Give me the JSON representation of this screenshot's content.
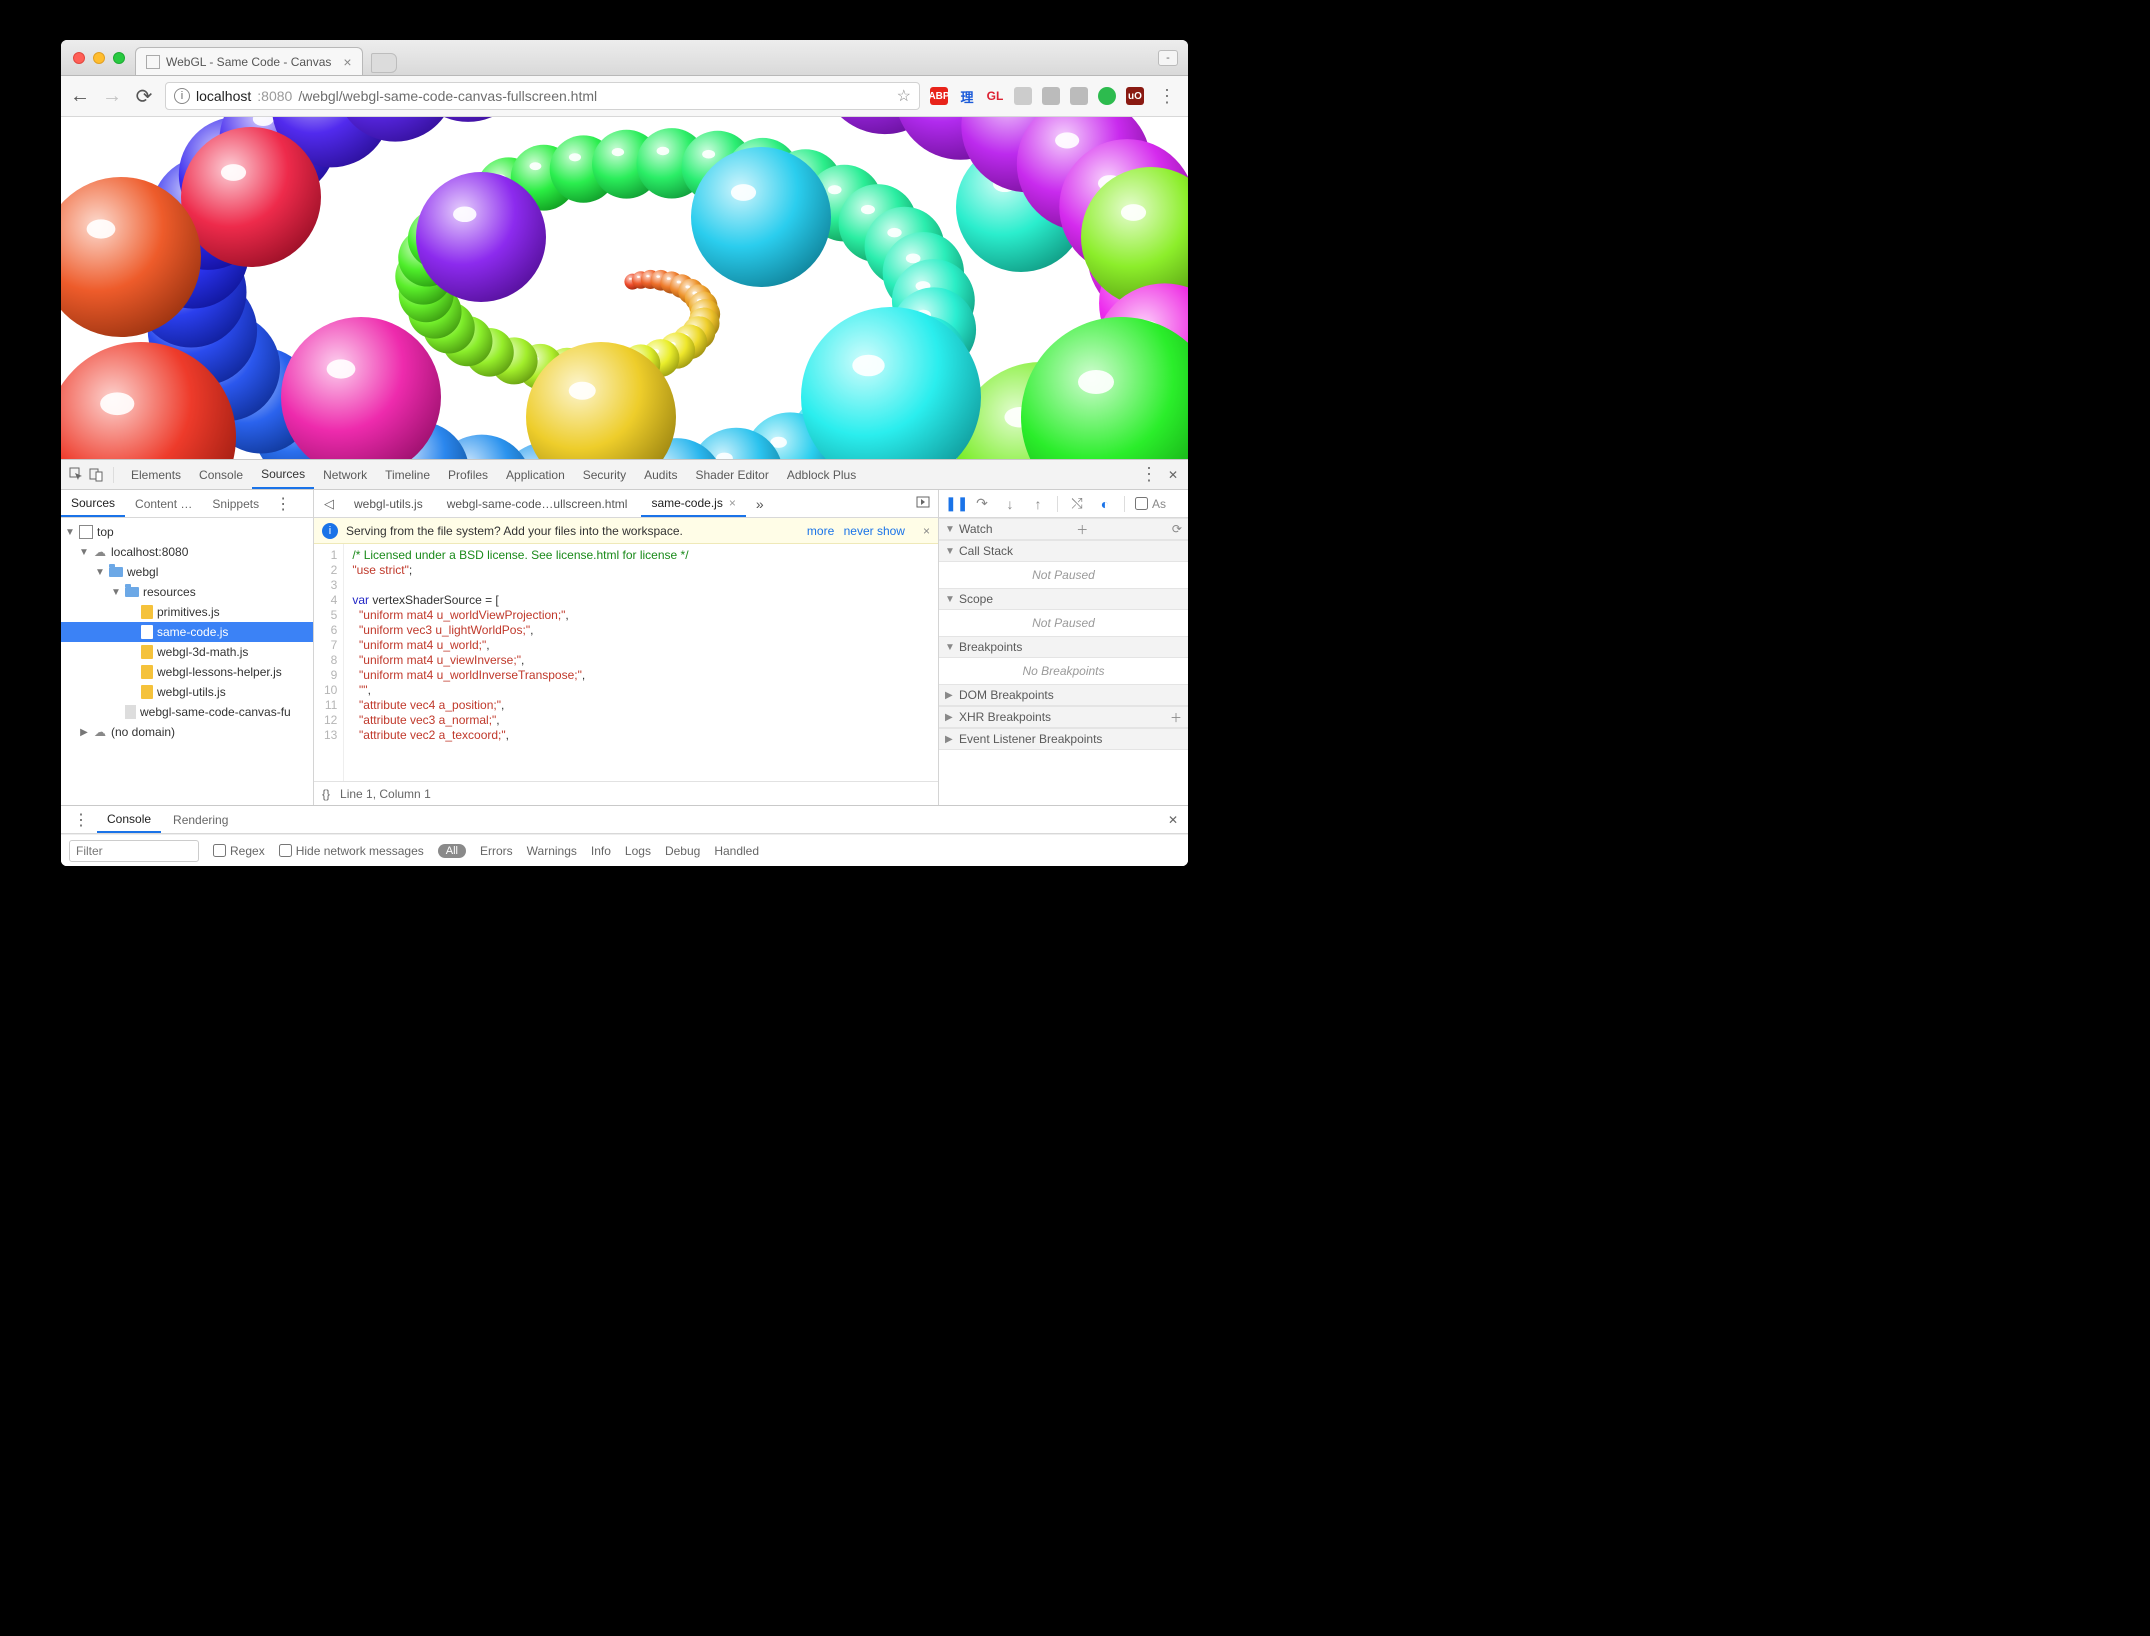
{
  "window": {
    "tab_title": "WebGL - Same Code - Canvas",
    "minimize_glyph": "-"
  },
  "toolbar": {
    "url_host": "localhost",
    "url_port": ":8080",
    "url_path": "/webgl/webgl-same-code-canvas-fullscreen.html",
    "ext_abp": "ABP",
    "ext_ri": "理",
    "ext_gl": "GL",
    "ext_uo": "uO"
  },
  "devtools": {
    "tabs": [
      "Elements",
      "Console",
      "Sources",
      "Network",
      "Timeline",
      "Profiles",
      "Application",
      "Security",
      "Audits",
      "Shader Editor",
      "Adblock Plus"
    ],
    "active_tab": "Sources"
  },
  "sources_left": {
    "tabs": [
      "Sources",
      "Content …",
      "Snippets"
    ],
    "active": "Sources",
    "tree": {
      "top": "top",
      "host": "localhost:8080",
      "folder1": "webgl",
      "folder2": "resources",
      "files": [
        "primitives.js",
        "same-code.js",
        "webgl-3d-math.js",
        "webgl-lessons-helper.js",
        "webgl-utils.js"
      ],
      "sel": "same-code.js",
      "rootfile": "webgl-same-code-canvas-fu",
      "nodomain": "(no domain)"
    }
  },
  "file_tabs": {
    "tabs": [
      "webgl-utils.js",
      "webgl-same-code…ullscreen.html",
      "same-code.js"
    ],
    "active": "same-code.js",
    "more_glyph": "»"
  },
  "infobar": {
    "msg": "Serving from the file system? Add your files into the workspace.",
    "link_more": "more",
    "link_never": "never show"
  },
  "code": {
    "lines": [
      {
        "n": 1,
        "seg": [
          [
            "com",
            "/* Licensed under a BSD license. See license.html for license */"
          ]
        ]
      },
      {
        "n": 2,
        "seg": [
          [
            "str",
            "\"use strict\""
          ],
          [
            "pl",
            ";"
          ]
        ]
      },
      {
        "n": 3,
        "seg": [
          [
            "pl",
            ""
          ]
        ]
      },
      {
        "n": 4,
        "seg": [
          [
            "kw",
            "var"
          ],
          [
            "pl",
            " vertexShaderSource = ["
          ]
        ]
      },
      {
        "n": 5,
        "seg": [
          [
            "pl",
            "  "
          ],
          [
            "str",
            "\"uniform mat4 u_worldViewProjection;\""
          ],
          [
            "pl",
            ","
          ]
        ]
      },
      {
        "n": 6,
        "seg": [
          [
            "pl",
            "  "
          ],
          [
            "str",
            "\"uniform vec3 u_lightWorldPos;\""
          ],
          [
            "pl",
            ","
          ]
        ]
      },
      {
        "n": 7,
        "seg": [
          [
            "pl",
            "  "
          ],
          [
            "str",
            "\"uniform mat4 u_world;\""
          ],
          [
            "pl",
            ","
          ]
        ]
      },
      {
        "n": 8,
        "seg": [
          [
            "pl",
            "  "
          ],
          [
            "str",
            "\"uniform mat4 u_viewInverse;\""
          ],
          [
            "pl",
            ","
          ]
        ]
      },
      {
        "n": 9,
        "seg": [
          [
            "pl",
            "  "
          ],
          [
            "str",
            "\"uniform mat4 u_worldInverseTranspose;\""
          ],
          [
            "pl",
            ","
          ]
        ]
      },
      {
        "n": 10,
        "seg": [
          [
            "pl",
            "  "
          ],
          [
            "str",
            "\"\""
          ],
          [
            "pl",
            ","
          ]
        ]
      },
      {
        "n": 11,
        "seg": [
          [
            "pl",
            "  "
          ],
          [
            "str",
            "\"attribute vec4 a_position;\""
          ],
          [
            "pl",
            ","
          ]
        ]
      },
      {
        "n": 12,
        "seg": [
          [
            "pl",
            "  "
          ],
          [
            "str",
            "\"attribute vec3 a_normal;\""
          ],
          [
            "pl",
            ","
          ]
        ]
      },
      {
        "n": 13,
        "seg": [
          [
            "pl",
            "  "
          ],
          [
            "str",
            "\"attribute vec2 a_texcoord;\""
          ],
          [
            "pl",
            ","
          ]
        ]
      }
    ]
  },
  "status": {
    "braces": "{}",
    "pos": "Line 1, Column 1"
  },
  "debug": {
    "panes": [
      {
        "label": "Watch",
        "open": true,
        "body": null,
        "plus": true,
        "refresh": true
      },
      {
        "label": "Call Stack",
        "open": true,
        "body": "Not Paused"
      },
      {
        "label": "Scope",
        "open": true,
        "body": "Not Paused"
      },
      {
        "label": "Breakpoints",
        "open": true,
        "body": "No Breakpoints"
      },
      {
        "label": "DOM Breakpoints",
        "open": false
      },
      {
        "label": "XHR Breakpoints",
        "open": false,
        "plus": true
      },
      {
        "label": "Event Listener Breakpoints",
        "open": false
      }
    ],
    "async_label": "As"
  },
  "drawer": {
    "tabs": [
      "Console",
      "Rendering"
    ],
    "active": "Console",
    "filter_placeholder": "Filter",
    "regex": "Regex",
    "hide": "Hide network messages",
    "levels": [
      "All",
      "Errors",
      "Warnings",
      "Info",
      "Logs",
      "Debug",
      "Handled"
    ]
  }
}
